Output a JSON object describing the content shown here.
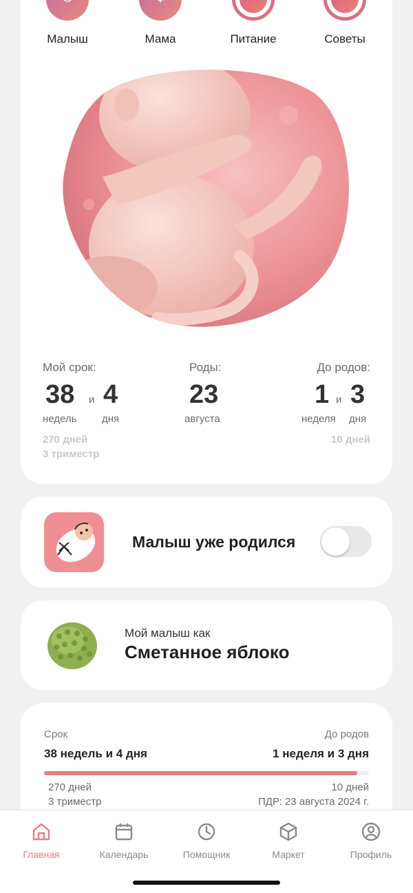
{
  "categories": [
    {
      "label": "Малыш",
      "icon": "baby-icon"
    },
    {
      "label": "Мама",
      "icon": "mother-icon"
    },
    {
      "label": "Питание",
      "icon": "nutrition-icon"
    },
    {
      "label": "Советы",
      "icon": "chat-icon"
    }
  ],
  "stats": {
    "term": {
      "label": "Мой срок:",
      "weeks": "38",
      "conj": "и",
      "days": "4",
      "weeks_unit": "недель",
      "days_unit": "дня",
      "total_days": "270 дней",
      "trimester": "3 триместр"
    },
    "birth": {
      "label": "Роды:",
      "day": "23",
      "month": "августа"
    },
    "until": {
      "label": "До родов:",
      "weeks": "1",
      "conj": "и",
      "days": "3",
      "weeks_unit": "неделя",
      "days_unit": "дня",
      "total_days": "10 дней"
    }
  },
  "born_card": {
    "text": "Малыш уже родился",
    "toggle_on": false
  },
  "fruit_card": {
    "prefix": "Мой малыш как",
    "name": "Сметанное яблоко"
  },
  "progress": {
    "left_label": "Срок",
    "left_value": "38 недель и 4 дня",
    "right_label": "До родов",
    "right_value": "1 неделя и 3 дня",
    "fraction": 0.964,
    "left_days": "270 дней",
    "left_trimester": "3 триместр",
    "right_days": "10 дней",
    "due_date": "ПДР: 23 августа 2024 г."
  },
  "colors": {
    "accent": "#e77d84",
    "toggle_off": "#e9e9eb"
  },
  "nav": [
    {
      "label": "Главная",
      "icon": "home-icon",
      "active": true
    },
    {
      "label": "Календарь",
      "icon": "calendar-icon",
      "active": false
    },
    {
      "label": "Помощник",
      "icon": "clock-icon",
      "active": false
    },
    {
      "label": "Маркет",
      "icon": "box-icon",
      "active": false
    },
    {
      "label": "Профиль",
      "icon": "profile-icon",
      "active": false
    }
  ]
}
